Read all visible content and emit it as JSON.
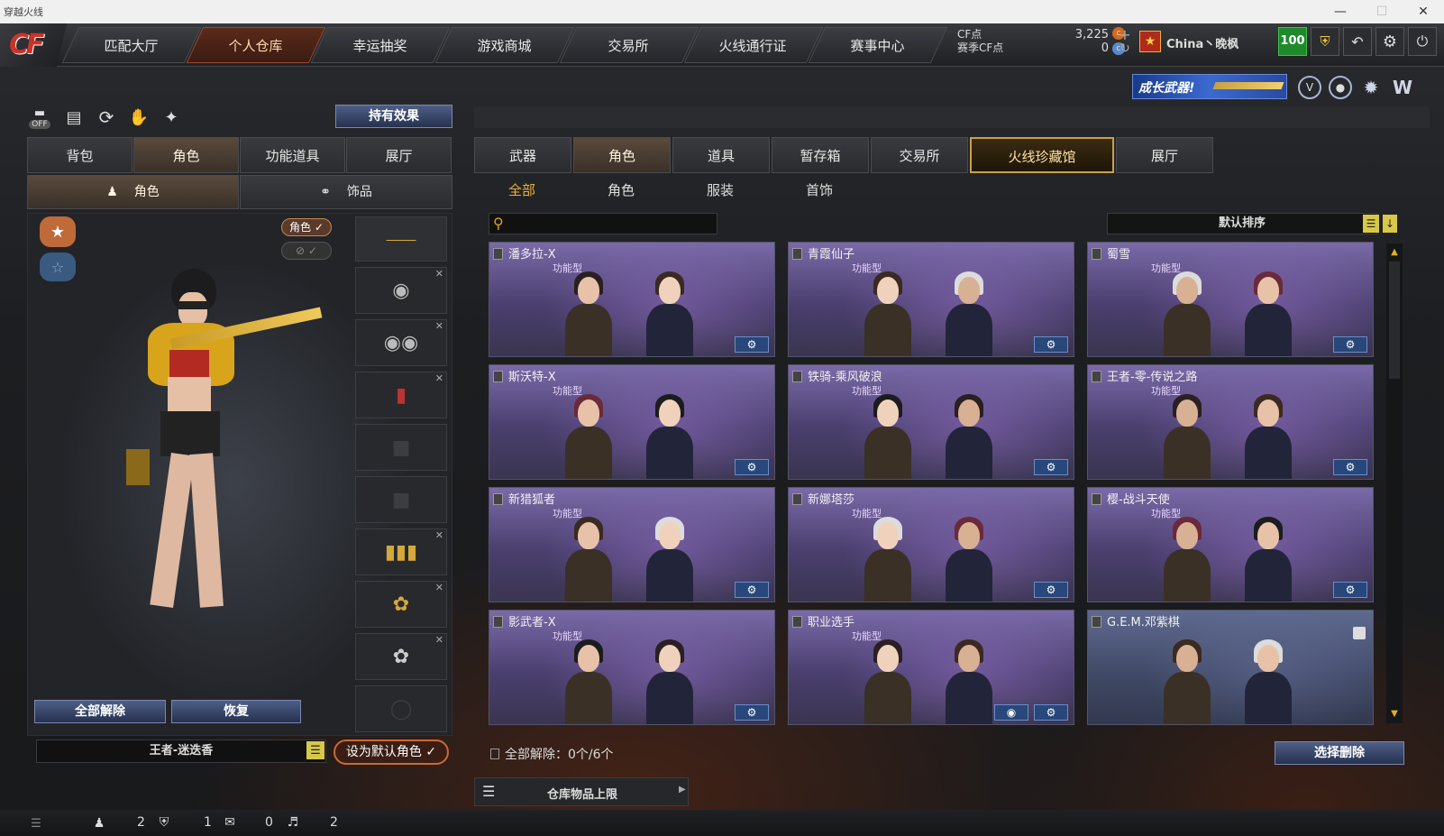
{
  "window": {
    "title": "穿越火线"
  },
  "topnav": {
    "items": [
      "匹配大厅",
      "个人仓库",
      "幸运抽奖",
      "游戏商城",
      "交易所",
      "火线通行证",
      "赛事中心"
    ],
    "active": 1
  },
  "currency": {
    "cf_label": "CF点",
    "cf_value": "3,225",
    "season_label": "赛季CF点",
    "season_value": "0"
  },
  "user": {
    "name": "China丶晚枫",
    "level": "100"
  },
  "banner": {
    "text": "成长武器!"
  },
  "left": {
    "hold_effect": "持有效果",
    "tabs": [
      "背包",
      "角色",
      "功能道具",
      "展厅"
    ],
    "subtabs": [
      "角色",
      "饰品"
    ],
    "role_badge": "角色",
    "unequip_all": "全部解除",
    "restore": "恢复",
    "selected_role": "王者-迷迭香",
    "set_default": "设为默认角色"
  },
  "right": {
    "tabs": [
      "武器",
      "角色",
      "道具",
      "暂存箱",
      "交易所",
      "火线珍藏馆",
      "展厅"
    ],
    "active_tab": 5,
    "subtabs": [
      "全部",
      "角色",
      "服装",
      "首饰"
    ],
    "active_subtab": 0,
    "search_placeholder": "",
    "sort": "默认排序",
    "cards": [
      {
        "name": "潘多拉-X",
        "type": "功能型"
      },
      {
        "name": "青霞仙子",
        "type": "功能型"
      },
      {
        "name": "蜀雪",
        "type": "功能型"
      },
      {
        "name": "斯沃特-X",
        "type": "功能型"
      },
      {
        "name": "铁骑-乘风破浪",
        "type": "功能型"
      },
      {
        "name": "王者-零-传说之路",
        "type": "功能型"
      },
      {
        "name": "新猎狐者",
        "type": "功能型"
      },
      {
        "name": "新娜塔莎",
        "type": "功能型"
      },
      {
        "name": "樱-战斗天使",
        "type": "功能型"
      },
      {
        "name": "影武者-X",
        "type": "功能型"
      },
      {
        "name": "职业选手",
        "type": "功能型"
      },
      {
        "name": "G.E.M.邓紫棋",
        "type": ""
      }
    ],
    "unequip_status_label": "全部解除：",
    "unequip_status_value": "0个/6个",
    "select_delete": "选择删除",
    "storage_limit": "仓库物品上限"
  },
  "footer": {
    "counts": [
      "2",
      "1",
      "0",
      "2"
    ]
  },
  "colors": {
    "accent": "#a0472b",
    "blue_button": "#26314f",
    "card_purple": "#5a4d82"
  }
}
